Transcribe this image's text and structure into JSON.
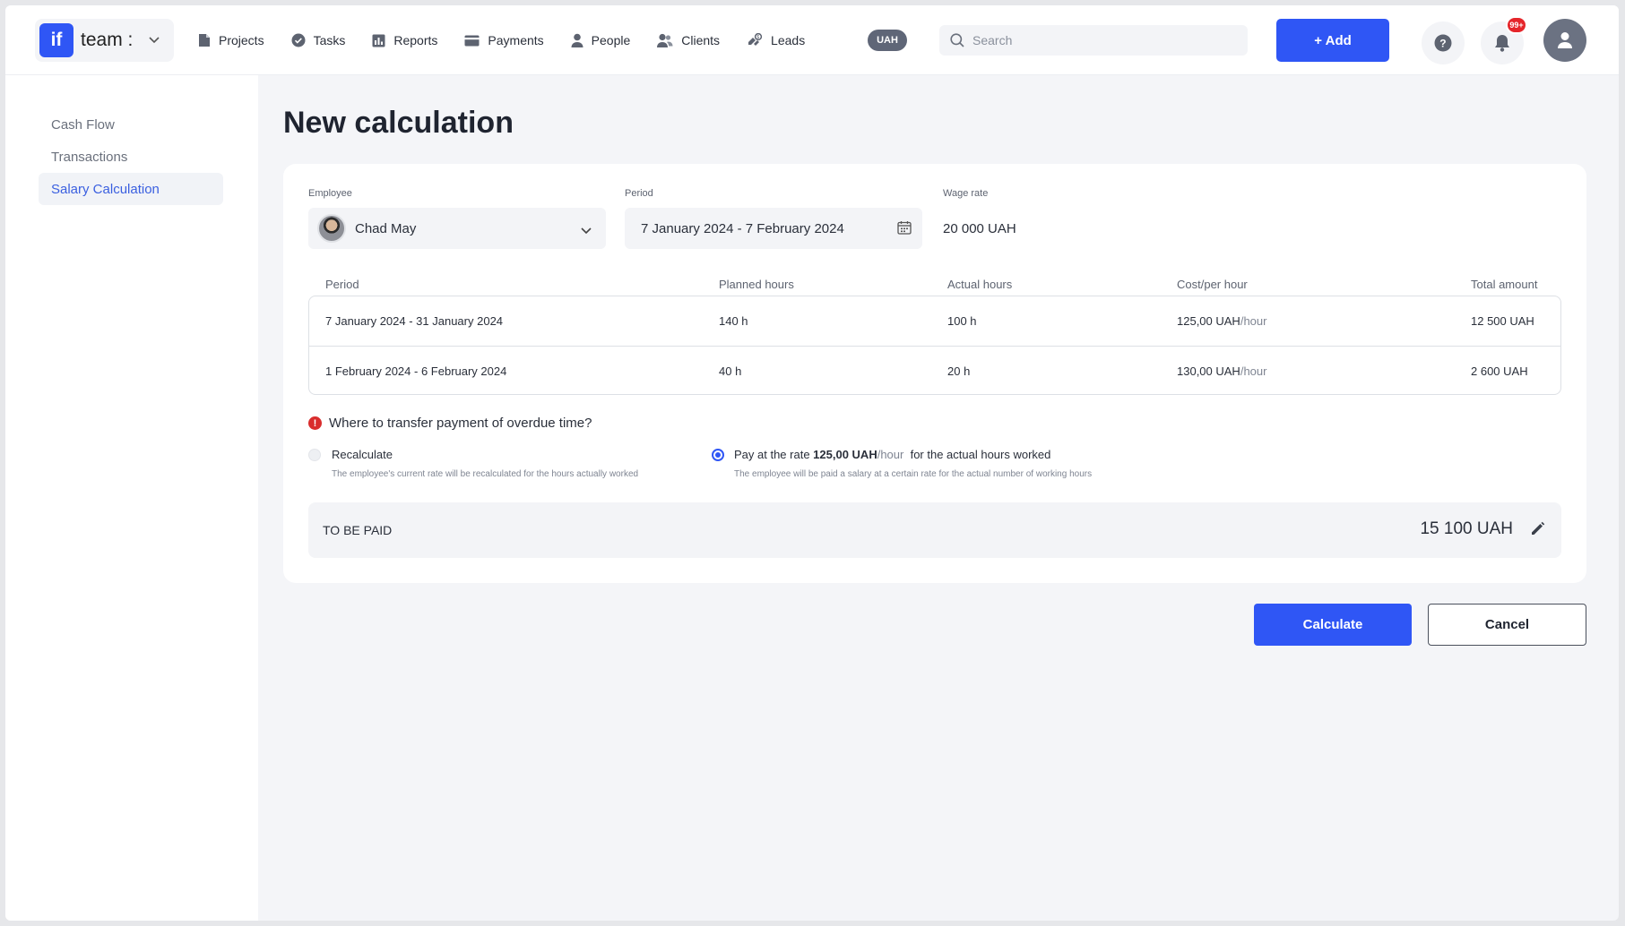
{
  "brand": {
    "logo": "if",
    "name": "team :"
  },
  "nav": [
    {
      "label": "Projects",
      "icon": "file-icon"
    },
    {
      "label": "Tasks",
      "icon": "check-circle-icon"
    },
    {
      "label": "Reports",
      "icon": "chart-icon"
    },
    {
      "label": "Payments",
      "icon": "card-icon"
    },
    {
      "label": "People",
      "icon": "person-icon"
    },
    {
      "label": "Clients",
      "icon": "clients-icon"
    },
    {
      "label": "Leads",
      "icon": "leads-icon"
    }
  ],
  "header": {
    "currency": "UAH",
    "search_placeholder": "Search",
    "add_label": "+ Add",
    "notifications_badge": "99+"
  },
  "sidebar": {
    "items": [
      {
        "label": "Cash Flow"
      },
      {
        "label": "Transactions"
      },
      {
        "label": "Salary Calculation",
        "active": true
      }
    ]
  },
  "page": {
    "title": "New calculation"
  },
  "form": {
    "employee_label": "Employee",
    "employee_value": "Chad May",
    "period_label": "Period",
    "period_value": "7 January 2024 - 7 February 2024",
    "wage_label": "Wage rate",
    "wage_value": "20 000 UAH"
  },
  "table": {
    "headers": {
      "period": "Period",
      "planned": "Planned hours",
      "actual": "Actual hours",
      "cost": "Cost/per hour",
      "total": "Total amount"
    },
    "rows": [
      {
        "period": "7 January 2024 - 31 January 2024",
        "planned": "140 h",
        "actual": "100 h",
        "cost": "125,00 UAH",
        "cost_unit": "/hour",
        "total": "12 500 UAH"
      },
      {
        "period": "1 February 2024 - 6 February 2024",
        "planned": "40 h",
        "actual": "20 h",
        "cost": "130,00 UAH",
        "cost_unit": "/hour",
        "total": "2 600 UAH"
      }
    ]
  },
  "transfer": {
    "question": "Where to transfer payment of overdue time?",
    "option1_title": "Recalculate",
    "option1_desc": "The employee's current rate will be recalculated for the hours actually worked",
    "option2_prefix": "Pay at the rate ",
    "option2_rate": "125,00 UAH",
    "option2_unit": "/hour",
    "option2_suffix": "  for the actual hours worked",
    "option2_desc": "The employee will be paid a salary at a certain rate for the actual number of working hours",
    "selected": 2
  },
  "summary": {
    "label": "TO BE PAID",
    "value": "15 100 UAH"
  },
  "actions": {
    "calculate": "Calculate",
    "cancel": "Cancel"
  },
  "colors": {
    "accent": "#2f56f5",
    "warning": "#d92d2d"
  }
}
